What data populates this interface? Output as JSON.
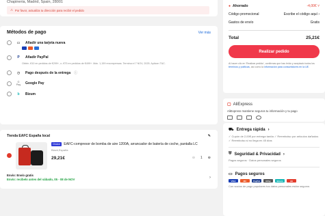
{
  "address": {
    "street": "Chapineria, Madrid, Spain, 28001",
    "warning": "Por favor, actualiza tu dirección para recibir el pedido"
  },
  "payment": {
    "title": "Métodos de pago",
    "more": "Ver más",
    "options": [
      {
        "label": "Añadir una tarjeta nueva",
        "icon": "credit-card-icon"
      },
      {
        "label": "Añadir PayPal",
        "icon": "paypal-icon"
      },
      {
        "label": "Pago después de la entrega",
        "icon": "clock-icon"
      },
      {
        "label": "Google Pay",
        "icon": "google-pay-icon",
        "prefix": "G Pay"
      },
      {
        "label": "Bizum",
        "icon": "bizum-icon"
      }
    ],
    "paypal_note": "Obtén -€10 en pedidos de €299+, o -€75 en pedidos de €499+. Máx. 1,159 recompensas. Termina el 7 NOV, 2025. Aplican T&C."
  },
  "store": {
    "name": "Tienda EAFC España local",
    "product_badge": "Choice",
    "product_name": "EAFC-compresor de bomba de aire 1200A, arrancador de batería de coche, pantalla LC",
    "variant": "Black,España",
    "price": "29,21€",
    "quantity": "1",
    "shipping_title": "Envío: Envío gratis",
    "shipping_eta": "Envío: recíbelo antes del sábado, 05 - 08 de NOV"
  },
  "summary": {
    "saved_label": "Ahorrado",
    "saved_value": "-4,00€",
    "promo_label": "Código promocional",
    "promo_value": "Escribe el código aquí",
    "shipping_label": "Gastos de envío",
    "shipping_value": "Gratis",
    "total_label": "Total",
    "total_value": "25,21€",
    "order_button": "Realizar pedido",
    "legal_prefix": "Al hacer clic en 'Realizar pedido', confirmas que has leído y aceptado todos los ",
    "legal_terms": "términos y políticas",
    "legal_mid": ", así como la ",
    "legal_info": "información para consumidores en la UE",
    "legal_end": "."
  },
  "aliexpress": {
    "logo": "AliExpress",
    "tagline": "AliExpress mantiene seguros tu información y tu pago"
  },
  "trust": {
    "delivery_title": "Entrega rápida",
    "delivery_text": "✓ Cupón de 2,00€ por entrega tardía  ✓ Reembolso por artículos dañados  ✓ Reembolso si no llega en 45 días",
    "security_title": "Seguridad & Privacidad",
    "security_text": "Pagos seguros · Datos personales seguros",
    "payments_title": "Pagos seguros",
    "payment_logos": [
      "VISA",
      "MC",
      "PayPal",
      "GPay",
      "Bizum",
      "AE"
    ],
    "payments_text": "Con socios de pago populares tus datos personales están seguros"
  },
  "colors": {
    "accent": "#f0384a",
    "link": "#1565d8",
    "success": "#1a9f3c"
  }
}
